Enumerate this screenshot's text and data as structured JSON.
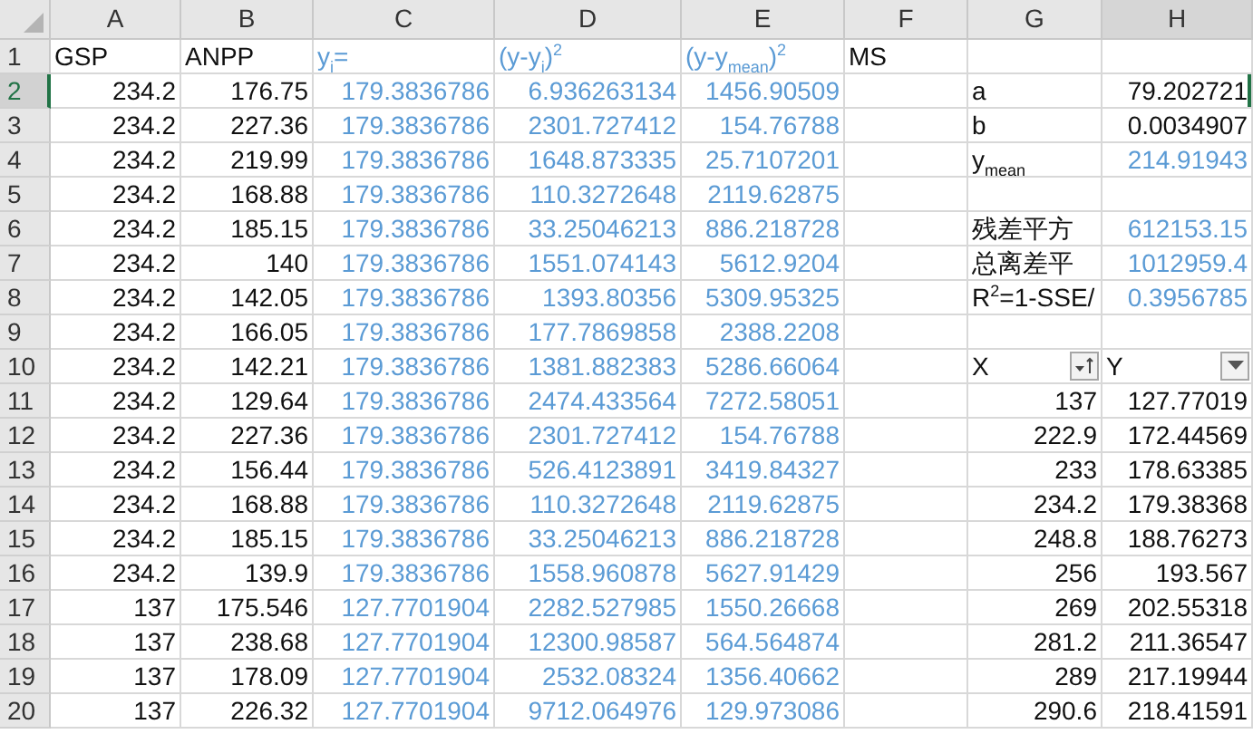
{
  "columns": [
    {
      "label": "A",
      "selected": false
    },
    {
      "label": "B",
      "selected": false
    },
    {
      "label": "C",
      "selected": false
    },
    {
      "label": "D",
      "selected": false
    },
    {
      "label": "E",
      "selected": false
    },
    {
      "label": "F",
      "selected": false
    },
    {
      "label": "G",
      "selected": false
    },
    {
      "label": "H",
      "selected": true
    }
  ],
  "rows": [
    {
      "number": "1",
      "selected": false,
      "cells": [
        {
          "t": "GSP",
          "kind": "label"
        },
        {
          "t": "ANPP",
          "kind": "label"
        },
        {
          "t": "y$_{i}$=",
          "kind": "calc_label"
        },
        {
          "t": "(y-y$_{i}$)$^{2}$",
          "kind": "calc_label"
        },
        {
          "t": "(y-y$_{mean}$)$^{2}$",
          "kind": "calc_label"
        },
        {
          "t": "MS",
          "kind": "label"
        },
        null,
        null
      ]
    },
    {
      "number": "2",
      "selected": true,
      "cells": [
        {
          "t": "234.2",
          "kind": "number"
        },
        {
          "t": "176.75",
          "kind": "number"
        },
        {
          "t": "179.3836786",
          "kind": "calc"
        },
        {
          "t": "6.936263134",
          "kind": "calc"
        },
        {
          "t": "1456.90509",
          "kind": "calc"
        },
        null,
        {
          "t": "a",
          "kind": "label"
        },
        {
          "t": "79.202721",
          "kind": "number"
        }
      ]
    },
    {
      "number": "3",
      "selected": false,
      "cells": [
        {
          "t": "234.2",
          "kind": "number"
        },
        {
          "t": "227.36",
          "kind": "number"
        },
        {
          "t": "179.3836786",
          "kind": "calc"
        },
        {
          "t": "2301.727412",
          "kind": "calc"
        },
        {
          "t": "154.76788",
          "kind": "calc"
        },
        null,
        {
          "t": "b",
          "kind": "label"
        },
        {
          "t": "0.0034907",
          "kind": "number"
        }
      ]
    },
    {
      "number": "4",
      "selected": false,
      "cells": [
        {
          "t": "234.2",
          "kind": "number"
        },
        {
          "t": "219.99",
          "kind": "number"
        },
        {
          "t": "179.3836786",
          "kind": "calc"
        },
        {
          "t": "1648.873335",
          "kind": "calc"
        },
        {
          "t": "25.7107201",
          "kind": "calc"
        },
        null,
        {
          "t": "y$_{mean}$",
          "kind": "label"
        },
        {
          "t": "214.91943",
          "kind": "calc"
        }
      ]
    },
    {
      "number": "5",
      "selected": false,
      "cells": [
        {
          "t": "234.2",
          "kind": "number"
        },
        {
          "t": "168.88",
          "kind": "number"
        },
        {
          "t": "179.3836786",
          "kind": "calc"
        },
        {
          "t": "110.3272648",
          "kind": "calc"
        },
        {
          "t": "2119.62875",
          "kind": "calc"
        },
        null,
        null,
        null
      ]
    },
    {
      "number": "6",
      "selected": false,
      "cells": [
        {
          "t": "234.2",
          "kind": "number"
        },
        {
          "t": "185.15",
          "kind": "number"
        },
        {
          "t": "179.3836786",
          "kind": "calc"
        },
        {
          "t": "33.25046213",
          "kind": "calc"
        },
        {
          "t": "886.218728",
          "kind": "calc"
        },
        null,
        {
          "t": "残差平方",
          "kind": "label"
        },
        {
          "t": "612153.15",
          "kind": "calc"
        }
      ]
    },
    {
      "number": "7",
      "selected": false,
      "cells": [
        {
          "t": "234.2",
          "kind": "number"
        },
        {
          "t": "140",
          "kind": "number"
        },
        {
          "t": "179.3836786",
          "kind": "calc"
        },
        {
          "t": "1551.074143",
          "kind": "calc"
        },
        {
          "t": "5612.9204",
          "kind": "calc"
        },
        null,
        {
          "t": "总离差平",
          "kind": "label"
        },
        {
          "t": "1012959.4",
          "kind": "calc"
        }
      ]
    },
    {
      "number": "8",
      "selected": false,
      "cells": [
        {
          "t": "234.2",
          "kind": "number"
        },
        {
          "t": "142.05",
          "kind": "number"
        },
        {
          "t": "179.3836786",
          "kind": "calc"
        },
        {
          "t": "1393.80356",
          "kind": "calc"
        },
        {
          "t": "5309.95325",
          "kind": "calc"
        },
        null,
        {
          "t": "R$^{2}$=1-SSE/",
          "kind": "label"
        },
        {
          "t": "0.3956785",
          "kind": "calc"
        }
      ]
    },
    {
      "number": "9",
      "selected": false,
      "cells": [
        {
          "t": "234.2",
          "kind": "number"
        },
        {
          "t": "166.05",
          "kind": "number"
        },
        {
          "t": "179.3836786",
          "kind": "calc"
        },
        {
          "t": "177.7869858",
          "kind": "calc"
        },
        {
          "t": "2388.2208",
          "kind": "calc"
        },
        null,
        null,
        null
      ]
    },
    {
      "number": "10",
      "selected": false,
      "cells": [
        {
          "t": "234.2",
          "kind": "number"
        },
        {
          "t": "142.21",
          "kind": "number"
        },
        {
          "t": "179.3836786",
          "kind": "calc"
        },
        {
          "t": "1381.882383",
          "kind": "calc"
        },
        {
          "t": "5286.66064",
          "kind": "calc"
        },
        null,
        {
          "t": "X",
          "kind": "sorted_filter"
        },
        {
          "t": "Y",
          "kind": "filter"
        }
      ]
    },
    {
      "number": "11",
      "selected": false,
      "cells": [
        {
          "t": "234.2",
          "kind": "number"
        },
        {
          "t": "129.64",
          "kind": "number"
        },
        {
          "t": "179.3836786",
          "kind": "calc"
        },
        {
          "t": "2474.433564",
          "kind": "calc"
        },
        {
          "t": "7272.58051",
          "kind": "calc"
        },
        null,
        {
          "t": "137",
          "kind": "number"
        },
        {
          "t": "127.77019",
          "kind": "number"
        }
      ]
    },
    {
      "number": "12",
      "selected": false,
      "cells": [
        {
          "t": "234.2",
          "kind": "number"
        },
        {
          "t": "227.36",
          "kind": "number"
        },
        {
          "t": "179.3836786",
          "kind": "calc"
        },
        {
          "t": "2301.727412",
          "kind": "calc"
        },
        {
          "t": "154.76788",
          "kind": "calc"
        },
        null,
        {
          "t": "222.9",
          "kind": "number"
        },
        {
          "t": "172.44569",
          "kind": "number"
        }
      ]
    },
    {
      "number": "13",
      "selected": false,
      "cells": [
        {
          "t": "234.2",
          "kind": "number"
        },
        {
          "t": "156.44",
          "kind": "number"
        },
        {
          "t": "179.3836786",
          "kind": "calc"
        },
        {
          "t": "526.4123891",
          "kind": "calc"
        },
        {
          "t": "3419.84327",
          "kind": "calc"
        },
        null,
        {
          "t": "233",
          "kind": "number"
        },
        {
          "t": "178.63385",
          "kind": "number"
        }
      ]
    },
    {
      "number": "14",
      "selected": false,
      "cells": [
        {
          "t": "234.2",
          "kind": "number"
        },
        {
          "t": "168.88",
          "kind": "number"
        },
        {
          "t": "179.3836786",
          "kind": "calc"
        },
        {
          "t": "110.3272648",
          "kind": "calc"
        },
        {
          "t": "2119.62875",
          "kind": "calc"
        },
        null,
        {
          "t": "234.2",
          "kind": "number"
        },
        {
          "t": "179.38368",
          "kind": "number"
        }
      ]
    },
    {
      "number": "15",
      "selected": false,
      "cells": [
        {
          "t": "234.2",
          "kind": "number"
        },
        {
          "t": "185.15",
          "kind": "number"
        },
        {
          "t": "179.3836786",
          "kind": "calc"
        },
        {
          "t": "33.25046213",
          "kind": "calc"
        },
        {
          "t": "886.218728",
          "kind": "calc"
        },
        null,
        {
          "t": "248.8",
          "kind": "number"
        },
        {
          "t": "188.76273",
          "kind": "number"
        }
      ]
    },
    {
      "number": "16",
      "selected": false,
      "cells": [
        {
          "t": "234.2",
          "kind": "number"
        },
        {
          "t": "139.9",
          "kind": "number"
        },
        {
          "t": "179.3836786",
          "kind": "calc"
        },
        {
          "t": "1558.960878",
          "kind": "calc"
        },
        {
          "t": "5627.91429",
          "kind": "calc"
        },
        null,
        {
          "t": "256",
          "kind": "number"
        },
        {
          "t": "193.567",
          "kind": "number"
        }
      ]
    },
    {
      "number": "17",
      "selected": false,
      "cells": [
        {
          "t": "137",
          "kind": "number"
        },
        {
          "t": "175.546",
          "kind": "number"
        },
        {
          "t": "127.7701904",
          "kind": "calc"
        },
        {
          "t": "2282.527985",
          "kind": "calc"
        },
        {
          "t": "1550.26668",
          "kind": "calc"
        },
        null,
        {
          "t": "269",
          "kind": "number"
        },
        {
          "t": "202.55318",
          "kind": "number"
        }
      ]
    },
    {
      "number": "18",
      "selected": false,
      "cells": [
        {
          "t": "137",
          "kind": "number"
        },
        {
          "t": "238.68",
          "kind": "number"
        },
        {
          "t": "127.7701904",
          "kind": "calc"
        },
        {
          "t": "12300.98587",
          "kind": "calc"
        },
        {
          "t": "564.564874",
          "kind": "calc"
        },
        null,
        {
          "t": "281.2",
          "kind": "number"
        },
        {
          "t": "211.36547",
          "kind": "number"
        }
      ]
    },
    {
      "number": "19",
      "selected": false,
      "cells": [
        {
          "t": "137",
          "kind": "number"
        },
        {
          "t": "178.09",
          "kind": "number"
        },
        {
          "t": "127.7701904",
          "kind": "calc"
        },
        {
          "t": "2532.08324",
          "kind": "calc"
        },
        {
          "t": "1356.40662",
          "kind": "calc"
        },
        null,
        {
          "t": "289",
          "kind": "number"
        },
        {
          "t": "217.19944",
          "kind": "number"
        }
      ]
    },
    {
      "number": "20",
      "selected": false,
      "cells": [
        {
          "t": "137",
          "kind": "number"
        },
        {
          "t": "226.32",
          "kind": "number"
        },
        {
          "t": "127.7701904",
          "kind": "calc"
        },
        {
          "t": "9712.064976",
          "kind": "calc"
        },
        {
          "t": "129.973086",
          "kind": "calc"
        },
        null,
        {
          "t": "290.6",
          "kind": "number"
        },
        {
          "t": "218.41591",
          "kind": "number"
        }
      ]
    }
  ]
}
